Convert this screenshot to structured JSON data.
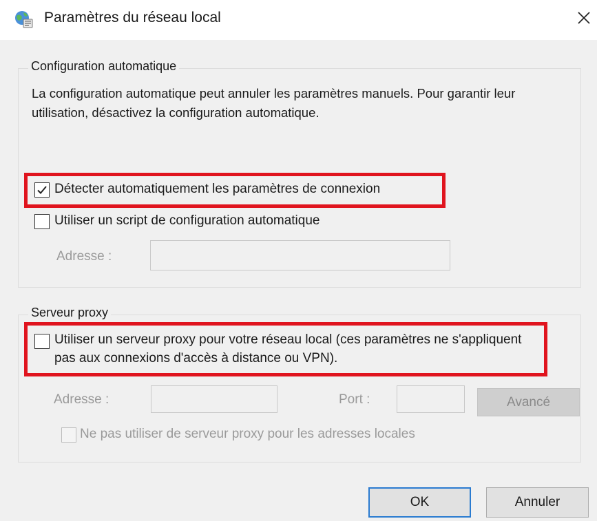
{
  "window": {
    "title": "Paramètres du réseau local",
    "icon": "network-globe-icon"
  },
  "auto_config": {
    "legend": "Configuration automatique",
    "description": "La configuration automatique peut annuler les paramètres manuels. Pour garantir leur utilisation, désactivez la configuration automatique.",
    "detect_label": "Détecter automatiquement les paramètres de connexion",
    "detect_checked": true,
    "script_label": "Utiliser un script de configuration automatique",
    "script_checked": false,
    "address_label": "Adresse :",
    "address_value": ""
  },
  "proxy": {
    "legend": "Serveur proxy",
    "use_proxy_label": "Utiliser un serveur proxy pour votre réseau local (ces paramètres ne s'appliquent pas aux connexions d'accès à distance ou VPN).",
    "use_proxy_checked": false,
    "address_label": "Adresse :",
    "address_value": "",
    "port_label": "Port :",
    "port_value": "",
    "advanced_label": "Avancé",
    "bypass_local_label": "Ne pas utiliser de serveur proxy pour les adresses locales",
    "bypass_local_checked": false
  },
  "buttons": {
    "ok_label": "OK",
    "cancel_label": "Annuler"
  },
  "colors": {
    "highlight": "#e0141e",
    "focus_border": "#2a7bd0"
  }
}
